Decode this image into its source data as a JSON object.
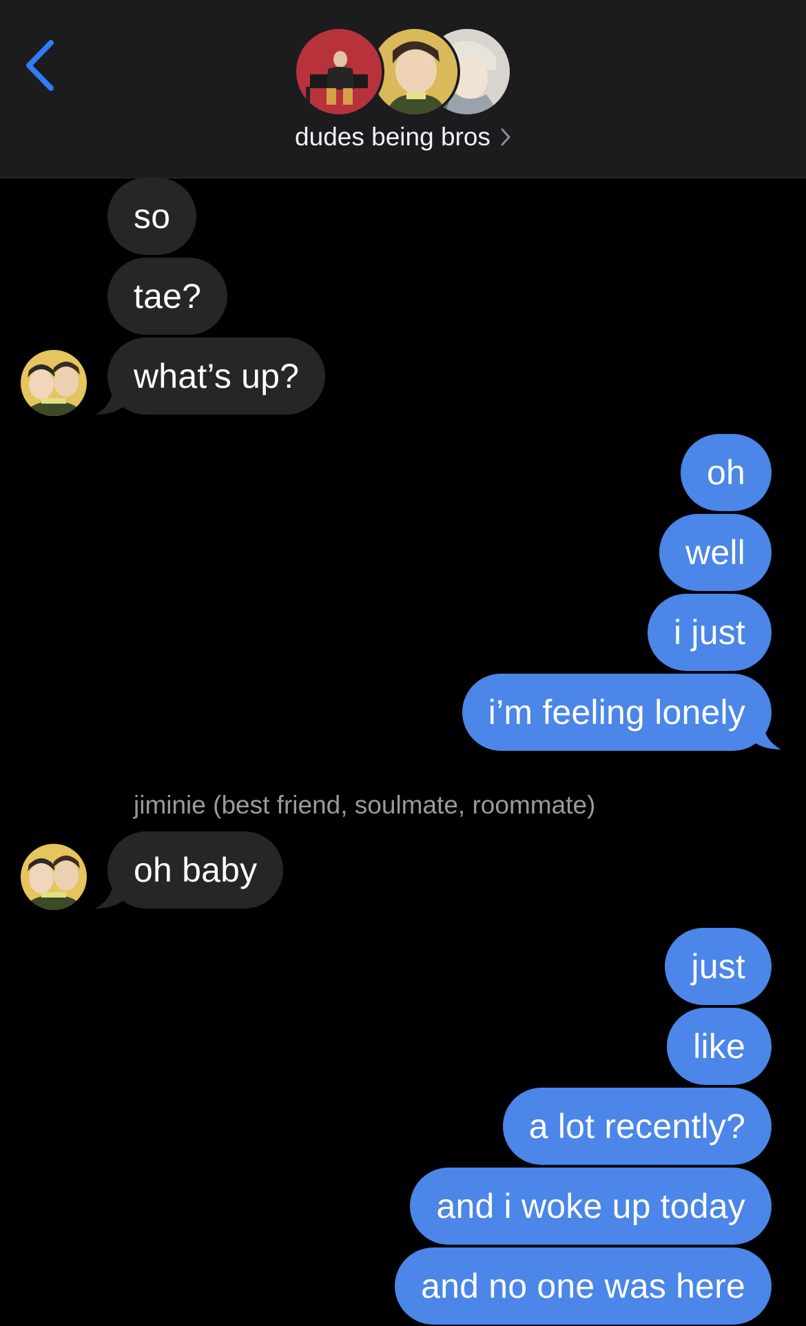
{
  "header": {
    "group_name": "dudes being bros",
    "back_icon": "chevron-left-icon",
    "accent_color": "#2f7cf6"
  },
  "messages": [
    {
      "from": "them",
      "text": "so"
    },
    {
      "from": "them",
      "text": "tae?"
    },
    {
      "from": "them",
      "text": "what’s up?"
    },
    {
      "from": "me",
      "text": "oh"
    },
    {
      "from": "me",
      "text": "well"
    },
    {
      "from": "me",
      "text": "i just"
    },
    {
      "from": "me",
      "text": "i’m feeling lonely"
    },
    {
      "from": "them",
      "text": "oh baby"
    },
    {
      "from": "me",
      "text": "just"
    },
    {
      "from": "me",
      "text": "like"
    },
    {
      "from": "me",
      "text": "a lot recently?"
    },
    {
      "from": "me",
      "text": "and i woke up today"
    },
    {
      "from": "me",
      "text": "and no one was here"
    }
  ],
  "sender_label": "jiminie (best friend, soulmate, roommate)",
  "colors": {
    "incoming_bubble": "#262629",
    "outgoing_bubble": "#4b86e8",
    "header_bg": "#1c1c1e",
    "background": "#000000"
  }
}
